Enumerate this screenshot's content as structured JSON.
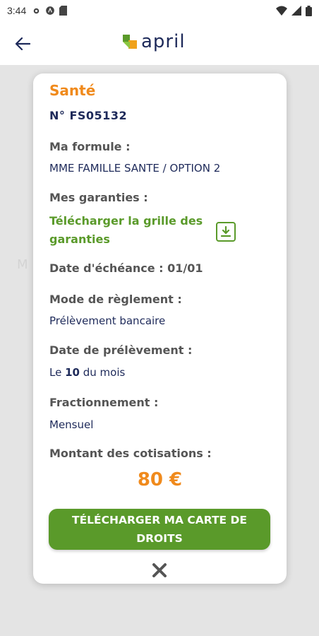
{
  "status_bar": {
    "time": "3:44"
  },
  "header": {
    "logo_text": "april"
  },
  "backdrop": {
    "ghost_text": "M"
  },
  "modal": {
    "title": "Santé",
    "contract_number": "N° FS05132",
    "formula_label": "Ma formule :",
    "formula_value": "MME FAMILLE SANTE / OPTION 2",
    "guarantees_label": "Mes garanties :",
    "download_grid_link": "Télécharger la grille des garanties",
    "due_date": "Date d'échéance : 01/01",
    "payment_mode_label": "Mode de règlement :",
    "payment_mode_value": "Prélèvement bancaire",
    "debit_date_label": "Date de prélèvement :",
    "debit_date_prefix": "Le",
    "debit_date_day": "10",
    "debit_date_suffix": "du mois",
    "split_label": "Fractionnement :",
    "split_value": "Mensuel",
    "amount_label": "Montant des cotisations :",
    "amount_value": "80 €",
    "cta_label": "TÉLÉCHARGER MA CARTE DE DROITS"
  },
  "colors": {
    "orange": "#f08a1c",
    "green": "#5a9a2a",
    "navy": "#1e2a5a"
  },
  "icons": [
    "gear-icon",
    "wifi-icon",
    "signal-icon",
    "battery-icon",
    "back-arrow-icon",
    "download-icon",
    "close-icon"
  ]
}
